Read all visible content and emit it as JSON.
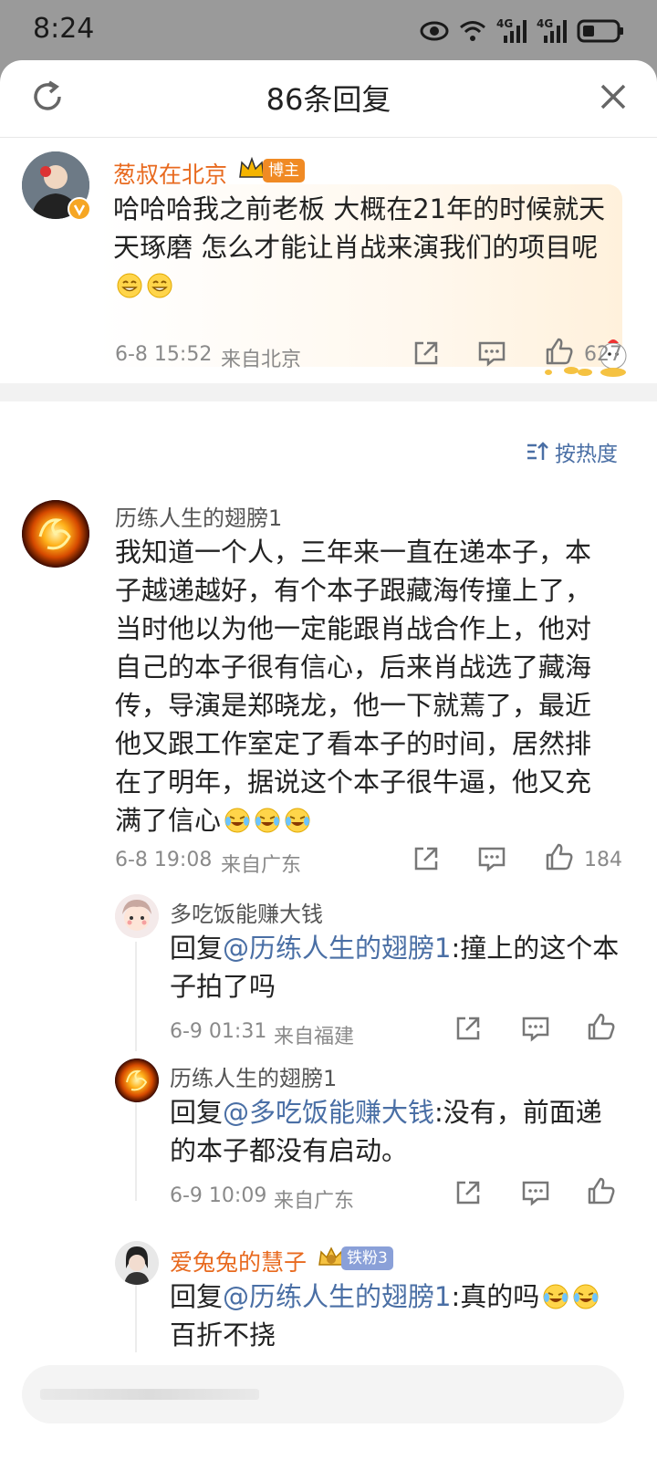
{
  "status_bar": {
    "time": "8:24",
    "signal_1": "4G",
    "signal_2": "4G"
  },
  "header": {
    "title": "86条回复"
  },
  "root_comment": {
    "author": "葱叔在北京",
    "badge": "博主",
    "text": "哈哈哈我之前老板 大概在21年的时候就天天琢磨 怎么才能让肖战来演我们的项目呢",
    "date": "6-8 15:52",
    "location": "来自北京",
    "likes": "627"
  },
  "sort": {
    "label": "按热度"
  },
  "comments": [
    {
      "author": "历练人生的翅膀1",
      "text": "我知道一个人，三年来一直在递本子，本子越递越好，有个本子跟藏海传撞上了，当时他以为他一定能跟肖战合作上，他对自己的本子很有信心，后来肖战选了藏海传，导演是郑晓龙，他一下就蔫了，最近他又跟工作室定了看本子的时间，居然排在了明年，据说这个本子很牛逼，他又充满了信心",
      "date": "6-8 19:08",
      "location": "来自广东",
      "likes": "184"
    }
  ],
  "replies": [
    {
      "author": "多吃饭能赚大钱",
      "reply_prefix": "回复",
      "mention": "@历练人生的翅膀1",
      "text": ":撞上的这个本子拍了吗",
      "date": "6-9 01:31",
      "location": "来自福建"
    },
    {
      "author": "历练人生的翅膀1",
      "reply_prefix": "回复",
      "mention": "@多吃饭能赚大钱",
      "text": ":没有，前面递的本子都没有启动。",
      "date": "6-9 10:09",
      "location": "来自广东"
    },
    {
      "author": "爱兔兔的慧子",
      "badge": "铁粉3",
      "reply_prefix": "回复",
      "mention": "@历练人生的翅膀1",
      "text": ":真的吗",
      "text2": "百折不挠"
    }
  ],
  "colors": {
    "accent_orange": "#e86a1f",
    "mention_blue": "#4a6fa5"
  }
}
